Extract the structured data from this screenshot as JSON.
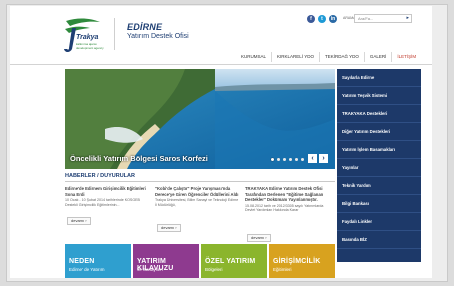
{
  "header": {
    "logo_name": "Trakya",
    "logo_sub": "kalkınma ajansı development agency",
    "office_title": "EDİRNE",
    "office_subtitle": "Yatırım Destek Ofisi",
    "social": [
      {
        "icon": "facebook-icon",
        "glyph": "f",
        "color": "#3b5998"
      },
      {
        "icon": "twitter-icon",
        "glyph": "t",
        "color": "#1e9ad6"
      },
      {
        "icon": "linkedin-icon",
        "glyph": "in",
        "color": "#2a6aa6"
      }
    ],
    "search_label": "ARAMA",
    "search_placeholder": "Ara/Fa...",
    "search_arrow": "▸",
    "nav": [
      "KURUMSAL",
      "KIRKLARELİ YDO",
      "TEKİRDAĞ YDO",
      "GALERİ",
      "İLETİŞİM"
    ]
  },
  "hero": {
    "caption": "Öncelikli Yatırım Bölgesi Saros Korfezi",
    "prev": "‹",
    "next": "›"
  },
  "sidebar": {
    "items": [
      "Sayılarla Edirne",
      "Yatırım Teşvik Sistemi",
      "TRAKYAKA Destekleri",
      "Diğer Yatırım Destekleri",
      "Yatırım İşlem Basamakları",
      "Yayınlar",
      "Teknik Yardım",
      "Bilgi Bankası",
      "Faydalı Linkler",
      "Basında BİZ"
    ]
  },
  "news": {
    "title": "HABERLER / DUYURULAR",
    "items": [
      {
        "head": "Edirne'de Edirnem Girişimcilik Eğitimleri Sona Erdi",
        "body": "10 Ocak - 10 Şubat 2014 tarihlerinde KOSGEB Destekli Girişimcilik Eğitimlerinin...",
        "more": "devamı ›"
      },
      {
        "head": "\"Kobi'de Çalıştır\" Proje Yarışması'nda Derece'ye Giren Öğrenciler Ödüllerini Aldı",
        "body": "Trakya Üniversitesi, Bilim Sanayi ve Teknoloji Edirne İl Müdürlüğü,",
        "more": "devamı ›"
      },
      {
        "head": "TRAKYAKA Edirne Yatırım Destek Ofisi Tarafından Derlenen \"Eğitime Sağlanan Destekler\" Dokümanı Yayınlanmıştır.",
        "body": "15.08.2012 tarih ve 2012/3305 sayılı Yatırımlarda Devlet Yardımları Hakkında Karar",
        "more": "devamı ›"
      }
    ]
  },
  "tiles": [
    {
      "title": "NEDEN",
      "sub": "Edirne' de Yatırım",
      "color": "#2f9fcf"
    },
    {
      "title": "YATIRIM KILAVUZU",
      "sub": "ve Sanayileri",
      "color": "#8e3a8f"
    },
    {
      "title": "ÖZEL YATIRIM",
      "sub": "Bölgeleri",
      "color": "#8bb52d"
    },
    {
      "title": "GİRİŞİMCİLİK",
      "sub": "Eğitimleri",
      "color": "#d8a21f"
    }
  ]
}
